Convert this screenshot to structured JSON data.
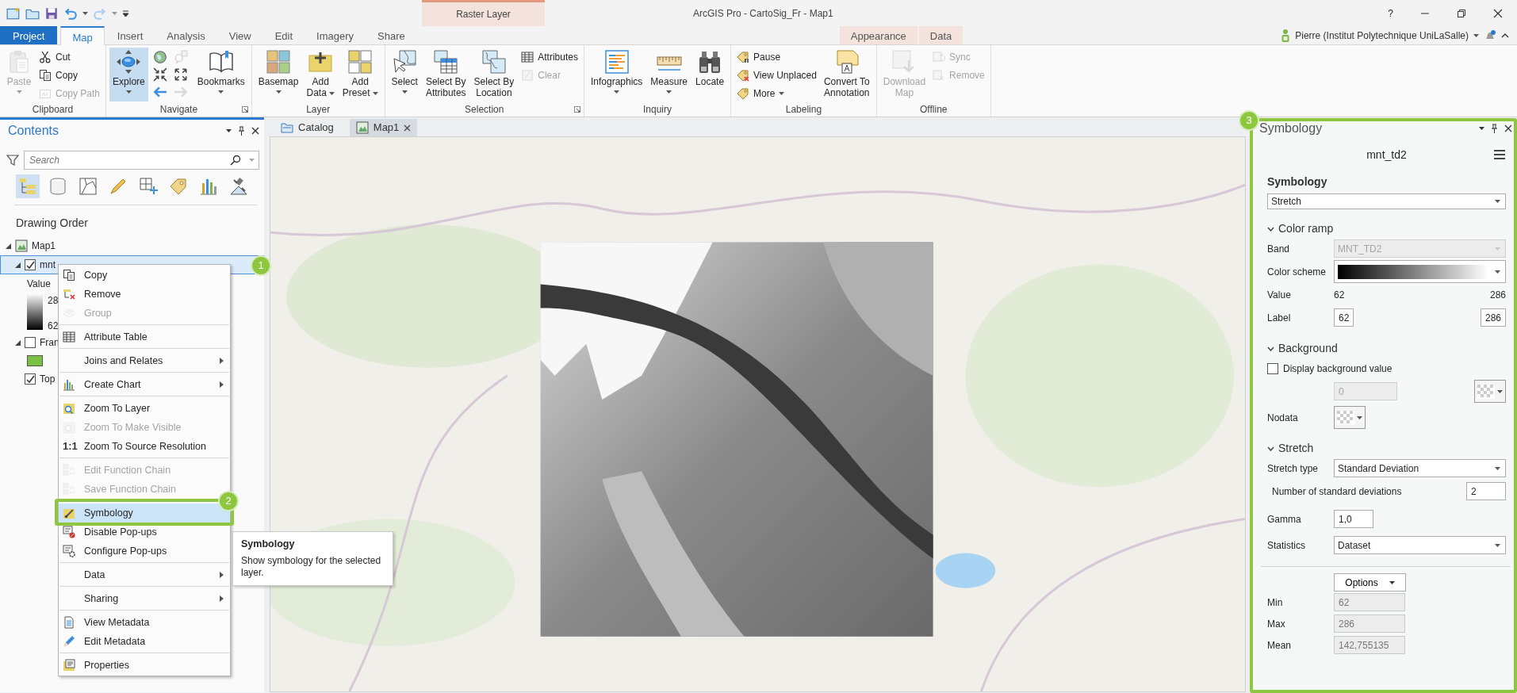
{
  "window": {
    "title": "ArcGIS Pro - CartoSig_Fr - Map1",
    "help": "?"
  },
  "contextual_group": "Raster Layer",
  "tabs": [
    {
      "label": "Project",
      "kind": "file",
      "selected": false
    },
    {
      "label": "Map",
      "kind": "normal",
      "selected": true
    },
    {
      "label": "Insert",
      "kind": "normal",
      "selected": false
    },
    {
      "label": "Analysis",
      "kind": "normal",
      "selected": false
    },
    {
      "label": "View",
      "kind": "normal",
      "selected": false
    },
    {
      "label": "Edit",
      "kind": "normal",
      "selected": false
    },
    {
      "label": "Imagery",
      "kind": "normal",
      "selected": false
    },
    {
      "label": "Share",
      "kind": "normal",
      "selected": false
    },
    {
      "label": "Appearance",
      "kind": "contextual",
      "selected": false
    },
    {
      "label": "Data",
      "kind": "contextual",
      "selected": false
    }
  ],
  "user": "Pierre (Institut Polytechnique UniLaSalle)",
  "ribbon_groups": [
    {
      "title": "Clipboard",
      "launcher": false,
      "buttons": [
        {
          "kind": "large",
          "label": "Paste",
          "dropdown": true,
          "disabled": true,
          "active": false
        },
        {
          "kind": "small",
          "label": "Cut",
          "dropdown": false,
          "disabled": false,
          "active": false
        },
        {
          "kind": "small",
          "label": "Copy",
          "dropdown": false,
          "disabled": false,
          "active": false
        },
        {
          "kind": "small",
          "label": "Copy Path",
          "dropdown": false,
          "disabled": true,
          "active": false
        }
      ]
    },
    {
      "title": "Navigate",
      "launcher": true,
      "buttons": [
        {
          "kind": "large",
          "label": "Explore",
          "dropdown": true,
          "disabled": false,
          "active": true
        },
        {
          "kind": "icon",
          "disabled": false
        },
        {
          "kind": "icon",
          "disabled": true
        },
        {
          "kind": "icon",
          "disabled": false
        },
        {
          "kind": "icon",
          "disabled": false
        },
        {
          "kind": "icon",
          "disabled": false
        },
        {
          "kind": "icon",
          "disabled": true
        },
        {
          "kind": "large",
          "label": "Bookmarks",
          "dropdown": true,
          "disabled": false,
          "active": false
        }
      ]
    },
    {
      "title": "Layer",
      "launcher": false,
      "buttons": [
        {
          "kind": "large",
          "label": "Basemap",
          "dropdown": true,
          "disabled": false,
          "active": false
        },
        {
          "kind": "large",
          "label": "Add\nData",
          "dropdown": true,
          "disabled": false,
          "active": false
        },
        {
          "kind": "large",
          "label": "Add\nPreset",
          "dropdown": true,
          "disabled": false,
          "active": false
        }
      ]
    },
    {
      "title": "Selection",
      "launcher": true,
      "buttons": [
        {
          "kind": "large",
          "label": "Select",
          "dropdown": true,
          "disabled": false,
          "active": false
        },
        {
          "kind": "large",
          "label": "Select By\nAttributes",
          "dropdown": false,
          "disabled": false,
          "active": false
        },
        {
          "kind": "large",
          "label": "Select By\nLocation",
          "dropdown": false,
          "disabled": false,
          "active": false
        },
        {
          "kind": "small",
          "label": "Attributes",
          "dropdown": false,
          "disabled": false,
          "active": false
        },
        {
          "kind": "small",
          "label": "Clear",
          "dropdown": false,
          "disabled": true,
          "active": false
        }
      ]
    },
    {
      "title": "Inquiry",
      "launcher": false,
      "buttons": [
        {
          "kind": "large",
          "label": "Infographics",
          "dropdown": true,
          "disabled": false,
          "active": false
        },
        {
          "kind": "large",
          "label": "Measure",
          "dropdown": true,
          "disabled": false,
          "active": false
        },
        {
          "kind": "large",
          "label": "Locate",
          "dropdown": false,
          "disabled": false,
          "active": false
        }
      ]
    },
    {
      "title": "Labeling",
      "launcher": false,
      "buttons": [
        {
          "kind": "small",
          "label": "Pause",
          "dropdown": false,
          "disabled": false,
          "active": false
        },
        {
          "kind": "small",
          "label": "View Unplaced",
          "dropdown": false,
          "disabled": false,
          "active": false
        },
        {
          "kind": "small",
          "label": "More",
          "dropdown": true,
          "disabled": false,
          "active": false
        },
        {
          "kind": "large",
          "label": "Convert To\nAnnotation",
          "dropdown": false,
          "disabled": false,
          "active": false
        }
      ]
    },
    {
      "title": "Offline",
      "launcher": false,
      "buttons": [
        {
          "kind": "large",
          "label": "Download\nMap",
          "dropdown": false,
          "disabled": true,
          "active": false
        },
        {
          "kind": "small",
          "label": "Sync",
          "dropdown": false,
          "disabled": true,
          "active": false
        },
        {
          "kind": "small",
          "label": "Remove",
          "dropdown": false,
          "disabled": true,
          "active": false
        }
      ]
    }
  ],
  "contents": {
    "title": "Contents",
    "search": {
      "placeholder": "Search"
    },
    "views": [
      {
        "selected": true
      },
      {
        "selected": false
      },
      {
        "selected": false
      },
      {
        "selected": false
      },
      {
        "selected": false
      },
      {
        "selected": false
      },
      {
        "selected": false
      },
      {
        "selected": false
      }
    ],
    "heading": "Drawing Order",
    "tree": [
      {
        "label": "Map1",
        "kind": "map",
        "expanded": true,
        "selected": false,
        "children": [
          {
            "label": "mnt",
            "expanded": true,
            "checked": true,
            "selected": true,
            "legend": {
              "title": "Value",
              "high": "28",
              "low": "62"
            }
          },
          {
            "label": "Fran",
            "expanded": true,
            "checked": false,
            "selected": false,
            "color": "#7ac143"
          },
          {
            "label": "Top",
            "checked": true,
            "selected": false
          }
        ]
      }
    ]
  },
  "context_menu": {
    "groups": [
      [
        {
          "label": "Copy",
          "disabled": false,
          "submenu": false,
          "selected": false
        },
        {
          "label": "Remove",
          "disabled": false,
          "submenu": false,
          "selected": false
        },
        {
          "label": "Group",
          "disabled": true,
          "submenu": false,
          "selected": false
        }
      ],
      [
        {
          "label": "Attribute Table",
          "disabled": false,
          "submenu": false,
          "selected": false
        }
      ],
      [
        {
          "label": "Joins and Relates",
          "disabled": false,
          "submenu": true,
          "selected": false
        }
      ],
      [
        {
          "label": "Create Chart",
          "disabled": false,
          "submenu": true,
          "selected": false
        }
      ],
      [
        {
          "label": "Zoom To Layer",
          "disabled": false,
          "submenu": false,
          "selected": false
        },
        {
          "label": "Zoom To Make Visible",
          "disabled": true,
          "submenu": false,
          "selected": false
        },
        {
          "label": "Zoom To Source Resolution",
          "glyph": "1:1",
          "disabled": false,
          "submenu": false,
          "selected": false
        }
      ],
      [
        {
          "label": "Edit Function Chain",
          "disabled": true,
          "submenu": false,
          "selected": false
        },
        {
          "label": "Save Function Chain",
          "disabled": true,
          "submenu": false,
          "selected": false
        }
      ],
      [
        {
          "label": "Symbology",
          "disabled": false,
          "submenu": false,
          "selected": true
        },
        {
          "label": "Disable Pop-ups",
          "disabled": false,
          "submenu": false,
          "selected": false
        },
        {
          "label": "Configure Pop-ups",
          "disabled": false,
          "submenu": false,
          "selected": false
        }
      ],
      [
        {
          "label": "Data",
          "disabled": false,
          "submenu": true,
          "selected": false
        }
      ],
      [
        {
          "label": "Sharing",
          "disabled": false,
          "submenu": true,
          "selected": false
        }
      ],
      [
        {
          "label": "View Metadata",
          "disabled": false,
          "submenu": false,
          "selected": false
        },
        {
          "label": "Edit Metadata",
          "disabled": false,
          "submenu": false,
          "selected": false
        }
      ],
      [
        {
          "label": "Properties",
          "disabled": false,
          "submenu": false,
          "selected": false
        }
      ]
    ]
  },
  "tooltip": {
    "title": "Symbology",
    "text": "Show symbology for the selected layer."
  },
  "map_view": {
    "tabs": [
      {
        "label": "Catalog",
        "selected": false,
        "closable": false
      },
      {
        "label": "Map1",
        "selected": true,
        "closable": true
      }
    ]
  },
  "symbology_pane": {
    "title": "Symbology",
    "layer": "mnt_td2",
    "heading": "Symbology",
    "type": "Stretch",
    "color_ramp": {
      "title": "Color ramp",
      "expanded": true,
      "band_label": "Band",
      "band": "MNT_TD2",
      "band_disabled": true,
      "scheme_label": "Color scheme",
      "value_label": "Value",
      "value_min": "62",
      "value_max": "286",
      "label_label": "Label",
      "label_min": "62",
      "label_max": "286"
    },
    "background": {
      "title": "Background",
      "expanded": true,
      "display_label": "Display background value",
      "display_checked": false,
      "value": "0",
      "value_disabled": true,
      "nodata_label": "Nodata"
    },
    "stretch": {
      "title": "Stretch",
      "expanded": true,
      "type_label": "Stretch type",
      "type": "Standard Deviation",
      "deviations_label": "Number of standard deviations",
      "deviations": "2",
      "gamma_label": "Gamma",
      "gamma": "1,0",
      "statistics_label": "Statistics",
      "statistics": "Dataset"
    },
    "options": "Options",
    "stats": [
      {
        "label": "Min",
        "value": "62"
      },
      {
        "label": "Max",
        "value": "286"
      },
      {
        "label": "Mean",
        "value": "142,755135"
      }
    ]
  },
  "callouts": [
    {
      "label": "1"
    },
    {
      "label": "2"
    },
    {
      "label": "3"
    }
  ]
}
